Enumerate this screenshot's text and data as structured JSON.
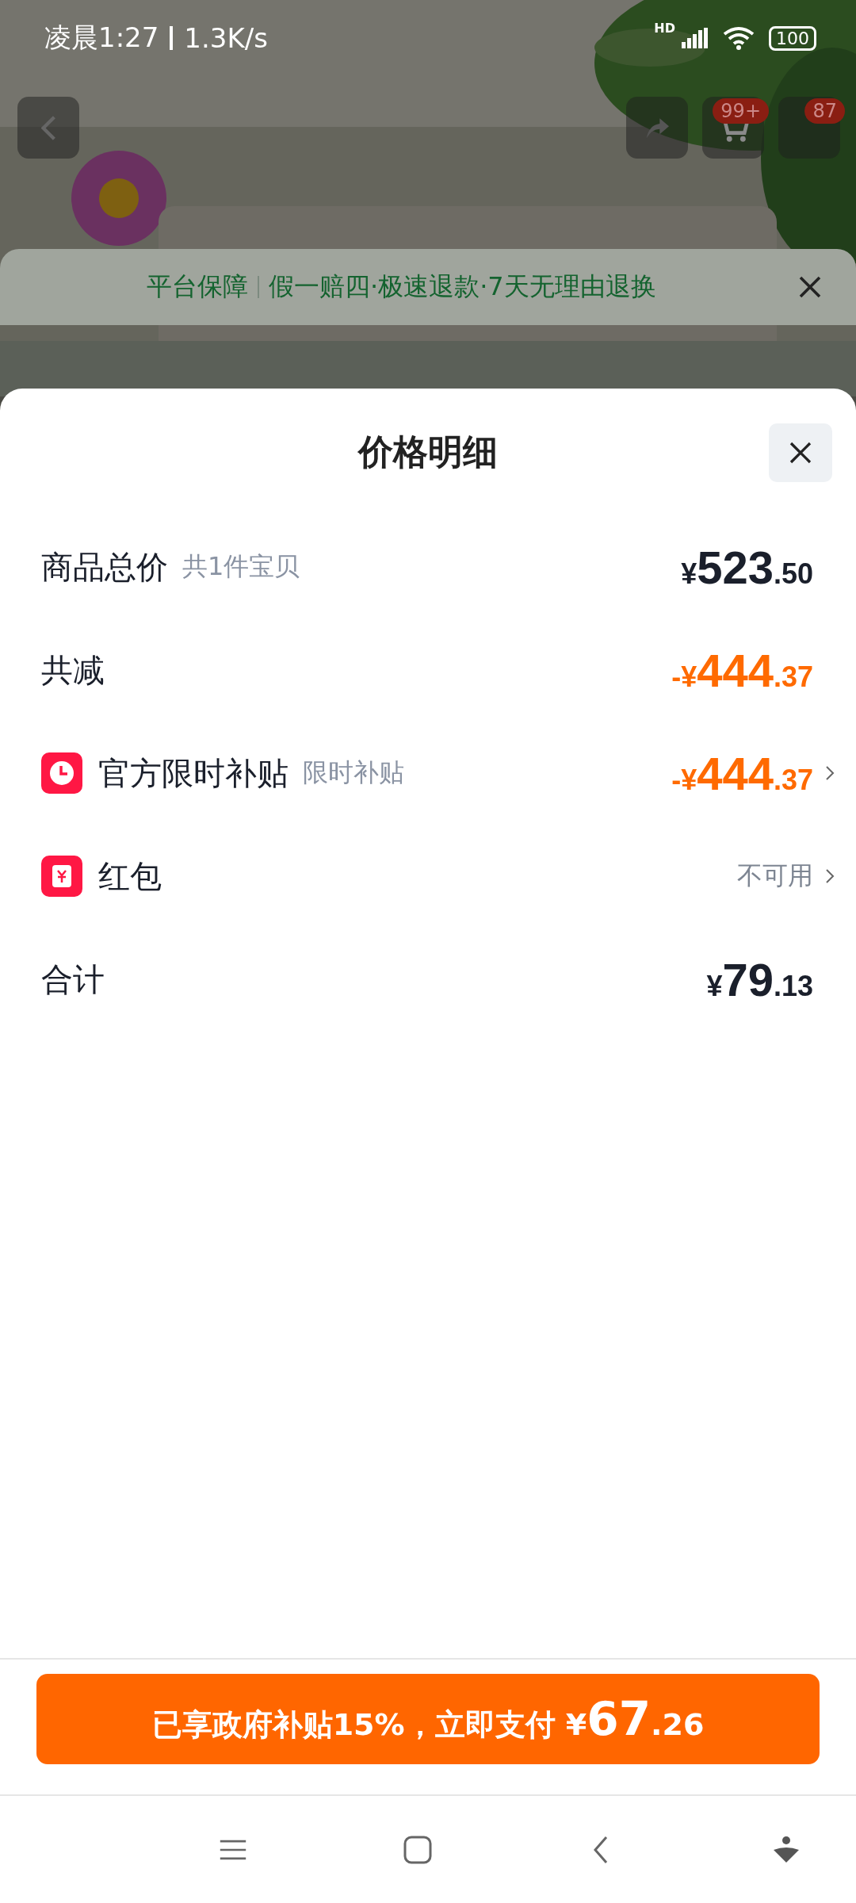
{
  "status_bar": {
    "time": "凌晨1:27",
    "speed": "1.3K/s",
    "network": "HD",
    "battery": "100"
  },
  "product_header": {
    "cart_badge": "99+",
    "message_badge": "87"
  },
  "guarantee_banner": {
    "label": "平台保障",
    "text": "假一赔四·极速退款·7天无理由退换"
  },
  "sheet": {
    "title": "价格明细",
    "rows": [
      {
        "kind": "price",
        "label": "商品总价",
        "note": "共1件宝贝",
        "price": {
          "currency": "¥",
          "integer": "523",
          "decimal": ".50"
        },
        "chevron": false
      },
      {
        "kind": "discount",
        "label": "共减",
        "price": {
          "sign": "-",
          "currency": "¥",
          "integer": "444",
          "decimal": ".37"
        },
        "chevron": false
      },
      {
        "kind": "subsidy",
        "label": "官方限时补贴",
        "note": "限时补贴",
        "price": {
          "sign": "-",
          "currency": "¥",
          "integer": "444",
          "decimal": ".37"
        },
        "chevron": true
      },
      {
        "kind": "voucher",
        "label": "红包",
        "value": "不可用",
        "chevron": true
      },
      {
        "kind": "price",
        "label": "合计",
        "price": {
          "currency": "¥",
          "integer": "79",
          "decimal": ".13"
        },
        "chevron": false
      }
    ]
  },
  "pay_button": {
    "text": "已享政府补贴15%，立即支付",
    "currency": "¥",
    "integer": "67",
    "decimal": ".26"
  }
}
